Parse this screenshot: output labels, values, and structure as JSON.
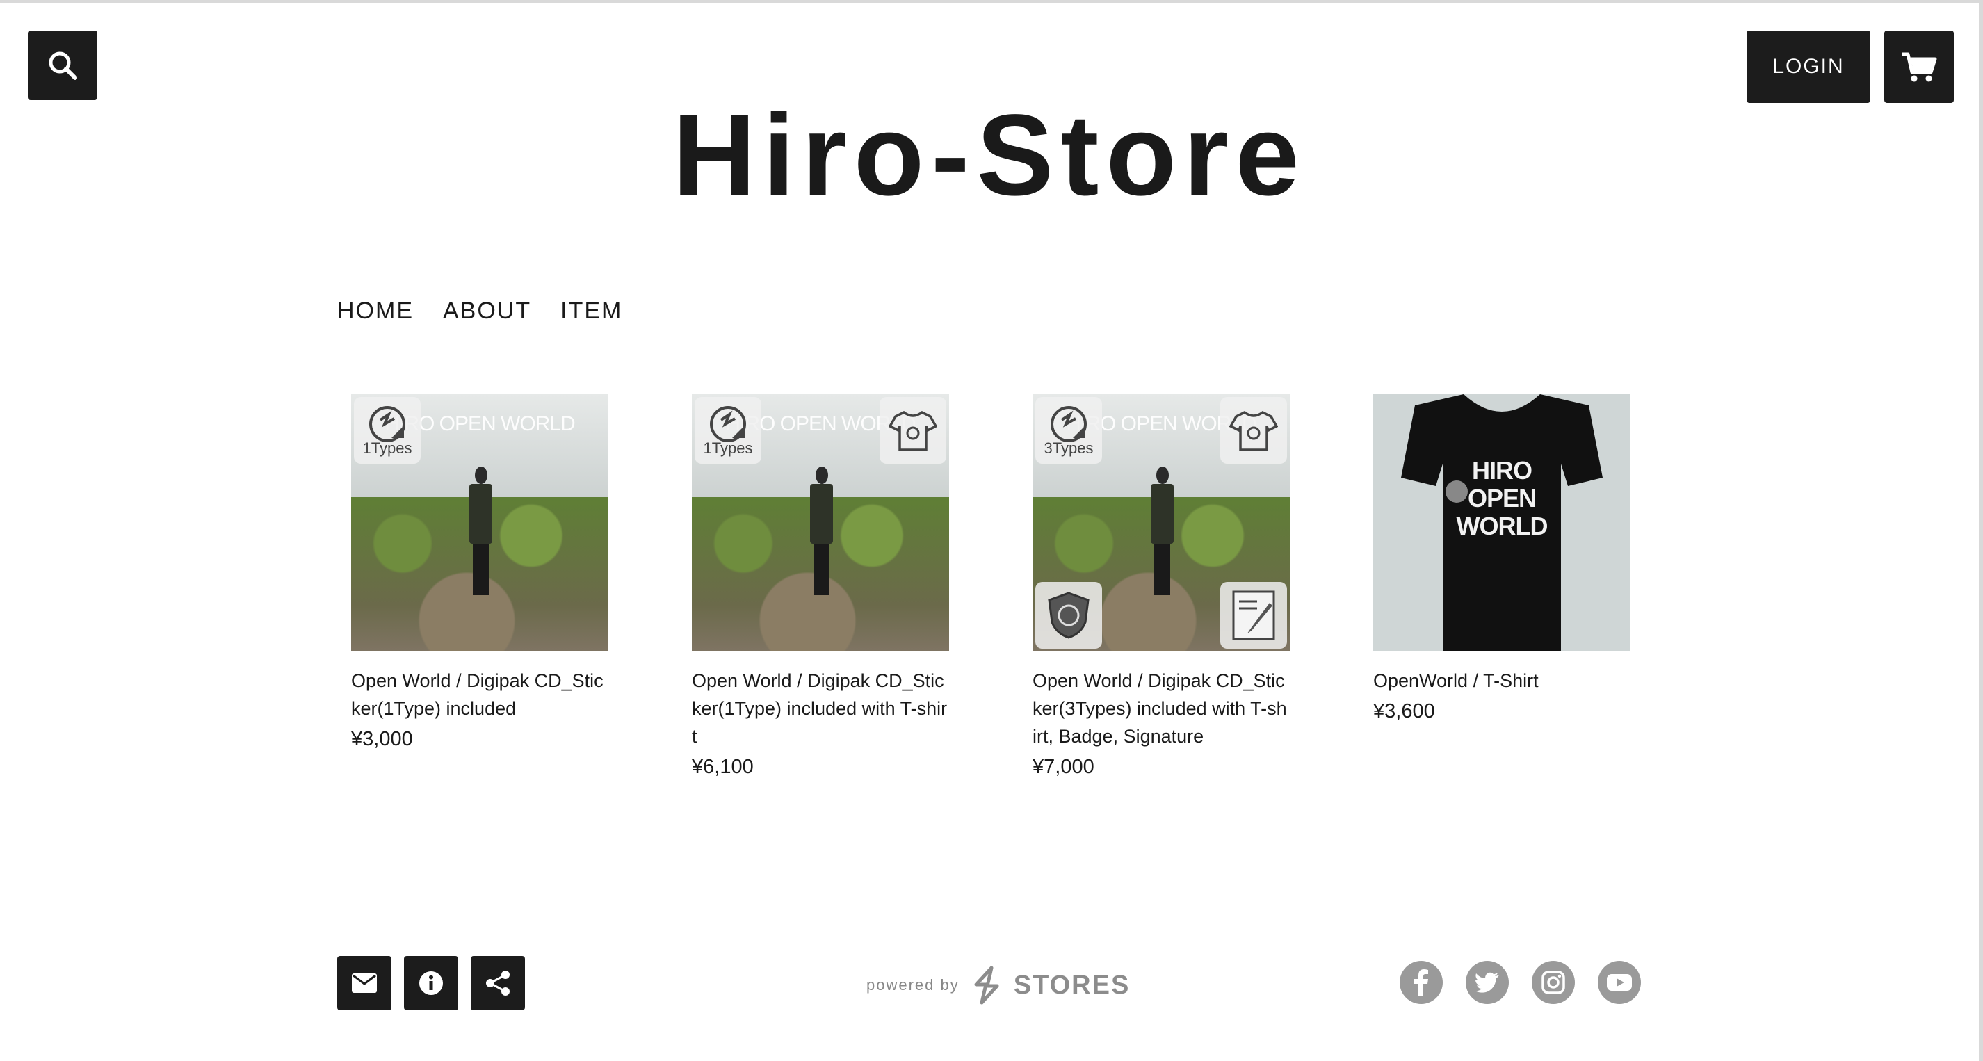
{
  "header": {
    "store_title": "Hiro-Store",
    "login_label": "LOGIN",
    "icons": {
      "search": "search-icon",
      "cart": "cart-icon"
    }
  },
  "nav": {
    "items": [
      {
        "label": "HOME"
      },
      {
        "label": "ABOUT"
      },
      {
        "label": "ITEM"
      }
    ]
  },
  "products": [
    {
      "name": "Open World / Digipak CD_Sticker(1Type) included",
      "price": "¥3,000",
      "image_caption": "HIRO OPEN WORLD",
      "badges": [
        {
          "icon": "sticker-icon",
          "text": "1Types"
        }
      ]
    },
    {
      "name": "Open World / Digipak CD_Sticker(1Type) included with T-shirt",
      "price": "¥6,100",
      "image_caption": "HIRO OPEN WORLD",
      "badges": [
        {
          "icon": "sticker-icon",
          "text": "1Types"
        },
        {
          "icon": "tshirt-icon",
          "text": ""
        }
      ]
    },
    {
      "name": "Open World / Digipak CD_Sticker(3Types) included with T-shirt, Badge, Signature",
      "price": "¥7,000",
      "image_caption": "HIRO OPEN WORLD",
      "badges": [
        {
          "icon": "sticker-icon",
          "text": "3Types"
        },
        {
          "icon": "tshirt-icon",
          "text": ""
        },
        {
          "icon": "badge-icon",
          "text": ""
        },
        {
          "icon": "signature-icon",
          "text": ""
        }
      ]
    },
    {
      "name": "OpenWorld / T-Shirt",
      "price": "¥3,600",
      "image_caption": "HIRO OPEN WORLD",
      "badges": []
    }
  ],
  "footer": {
    "buttons": [
      "mail-icon",
      "info-icon",
      "share-icon"
    ],
    "powered_by": "powered by",
    "brand": "STORES",
    "social": [
      "facebook-icon",
      "twitter-icon",
      "instagram-icon",
      "youtube-icon"
    ]
  },
  "colors": {
    "button_bg": "#1c1c1c",
    "social_icon_bg": "#9a9a9a",
    "text": "#1a1a1a"
  }
}
